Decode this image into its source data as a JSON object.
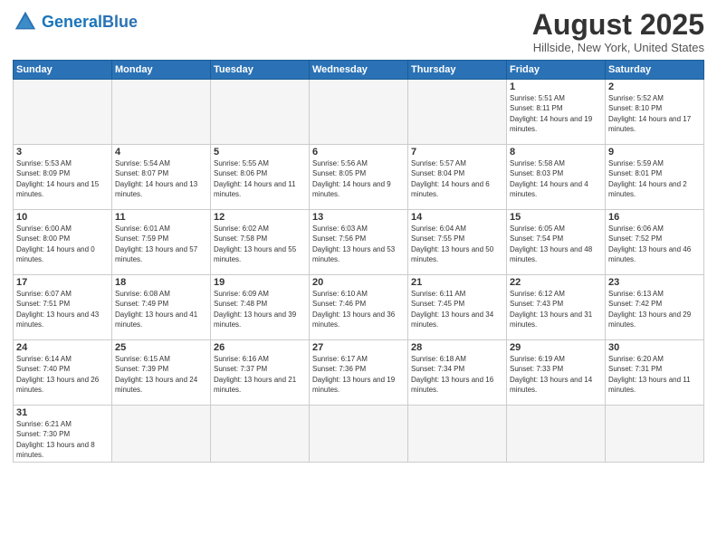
{
  "header": {
    "logo_general": "General",
    "logo_blue": "Blue",
    "title": "August 2025",
    "subtitle": "Hillside, New York, United States"
  },
  "days_of_week": [
    "Sunday",
    "Monday",
    "Tuesday",
    "Wednesday",
    "Thursday",
    "Friday",
    "Saturday"
  ],
  "weeks": [
    [
      {
        "day": "",
        "info": ""
      },
      {
        "day": "",
        "info": ""
      },
      {
        "day": "",
        "info": ""
      },
      {
        "day": "",
        "info": ""
      },
      {
        "day": "",
        "info": ""
      },
      {
        "day": "1",
        "info": "Sunrise: 5:51 AM\nSunset: 8:11 PM\nDaylight: 14 hours and 19 minutes."
      },
      {
        "day": "2",
        "info": "Sunrise: 5:52 AM\nSunset: 8:10 PM\nDaylight: 14 hours and 17 minutes."
      }
    ],
    [
      {
        "day": "3",
        "info": "Sunrise: 5:53 AM\nSunset: 8:09 PM\nDaylight: 14 hours and 15 minutes."
      },
      {
        "day": "4",
        "info": "Sunrise: 5:54 AM\nSunset: 8:07 PM\nDaylight: 14 hours and 13 minutes."
      },
      {
        "day": "5",
        "info": "Sunrise: 5:55 AM\nSunset: 8:06 PM\nDaylight: 14 hours and 11 minutes."
      },
      {
        "day": "6",
        "info": "Sunrise: 5:56 AM\nSunset: 8:05 PM\nDaylight: 14 hours and 9 minutes."
      },
      {
        "day": "7",
        "info": "Sunrise: 5:57 AM\nSunset: 8:04 PM\nDaylight: 14 hours and 6 minutes."
      },
      {
        "day": "8",
        "info": "Sunrise: 5:58 AM\nSunset: 8:03 PM\nDaylight: 14 hours and 4 minutes."
      },
      {
        "day": "9",
        "info": "Sunrise: 5:59 AM\nSunset: 8:01 PM\nDaylight: 14 hours and 2 minutes."
      }
    ],
    [
      {
        "day": "10",
        "info": "Sunrise: 6:00 AM\nSunset: 8:00 PM\nDaylight: 14 hours and 0 minutes."
      },
      {
        "day": "11",
        "info": "Sunrise: 6:01 AM\nSunset: 7:59 PM\nDaylight: 13 hours and 57 minutes."
      },
      {
        "day": "12",
        "info": "Sunrise: 6:02 AM\nSunset: 7:58 PM\nDaylight: 13 hours and 55 minutes."
      },
      {
        "day": "13",
        "info": "Sunrise: 6:03 AM\nSunset: 7:56 PM\nDaylight: 13 hours and 53 minutes."
      },
      {
        "day": "14",
        "info": "Sunrise: 6:04 AM\nSunset: 7:55 PM\nDaylight: 13 hours and 50 minutes."
      },
      {
        "day": "15",
        "info": "Sunrise: 6:05 AM\nSunset: 7:54 PM\nDaylight: 13 hours and 48 minutes."
      },
      {
        "day": "16",
        "info": "Sunrise: 6:06 AM\nSunset: 7:52 PM\nDaylight: 13 hours and 46 minutes."
      }
    ],
    [
      {
        "day": "17",
        "info": "Sunrise: 6:07 AM\nSunset: 7:51 PM\nDaylight: 13 hours and 43 minutes."
      },
      {
        "day": "18",
        "info": "Sunrise: 6:08 AM\nSunset: 7:49 PM\nDaylight: 13 hours and 41 minutes."
      },
      {
        "day": "19",
        "info": "Sunrise: 6:09 AM\nSunset: 7:48 PM\nDaylight: 13 hours and 39 minutes."
      },
      {
        "day": "20",
        "info": "Sunrise: 6:10 AM\nSunset: 7:46 PM\nDaylight: 13 hours and 36 minutes."
      },
      {
        "day": "21",
        "info": "Sunrise: 6:11 AM\nSunset: 7:45 PM\nDaylight: 13 hours and 34 minutes."
      },
      {
        "day": "22",
        "info": "Sunrise: 6:12 AM\nSunset: 7:43 PM\nDaylight: 13 hours and 31 minutes."
      },
      {
        "day": "23",
        "info": "Sunrise: 6:13 AM\nSunset: 7:42 PM\nDaylight: 13 hours and 29 minutes."
      }
    ],
    [
      {
        "day": "24",
        "info": "Sunrise: 6:14 AM\nSunset: 7:40 PM\nDaylight: 13 hours and 26 minutes."
      },
      {
        "day": "25",
        "info": "Sunrise: 6:15 AM\nSunset: 7:39 PM\nDaylight: 13 hours and 24 minutes."
      },
      {
        "day": "26",
        "info": "Sunrise: 6:16 AM\nSunset: 7:37 PM\nDaylight: 13 hours and 21 minutes."
      },
      {
        "day": "27",
        "info": "Sunrise: 6:17 AM\nSunset: 7:36 PM\nDaylight: 13 hours and 19 minutes."
      },
      {
        "day": "28",
        "info": "Sunrise: 6:18 AM\nSunset: 7:34 PM\nDaylight: 13 hours and 16 minutes."
      },
      {
        "day": "29",
        "info": "Sunrise: 6:19 AM\nSunset: 7:33 PM\nDaylight: 13 hours and 14 minutes."
      },
      {
        "day": "30",
        "info": "Sunrise: 6:20 AM\nSunset: 7:31 PM\nDaylight: 13 hours and 11 minutes."
      }
    ],
    [
      {
        "day": "31",
        "info": "Sunrise: 6:21 AM\nSunset: 7:30 PM\nDaylight: 13 hours and 8 minutes."
      },
      {
        "day": "",
        "info": ""
      },
      {
        "day": "",
        "info": ""
      },
      {
        "day": "",
        "info": ""
      },
      {
        "day": "",
        "info": ""
      },
      {
        "day": "",
        "info": ""
      },
      {
        "day": "",
        "info": ""
      }
    ]
  ]
}
